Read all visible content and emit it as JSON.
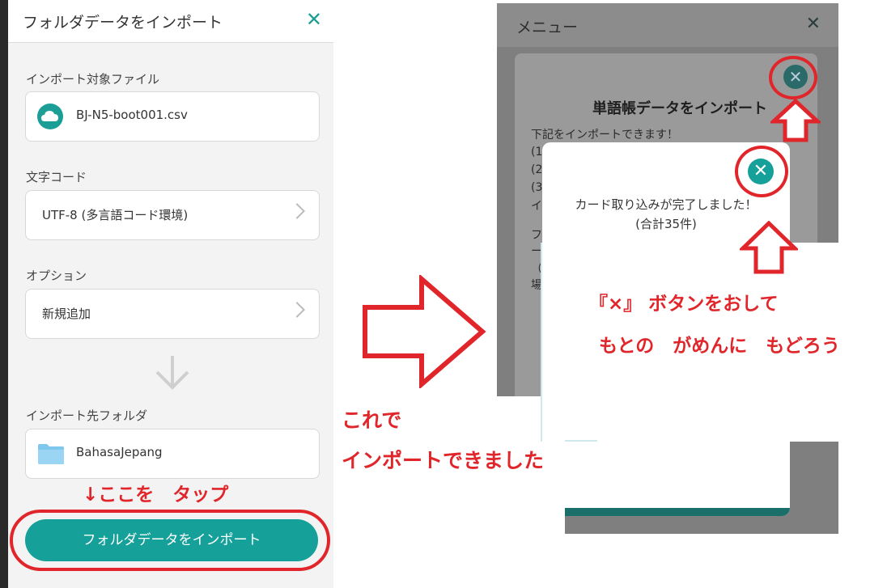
{
  "left_panel": {
    "title": "フォルダデータをインポート",
    "close_glyph": "✕",
    "import_file": {
      "label": "インポート対象ファイル",
      "value": "BJ-N5-boot001.csv",
      "icon": "cloud-icon"
    },
    "encoding": {
      "label": "文字コード",
      "value": "UTF-8 (多言語コード環境)"
    },
    "option": {
      "label": "オプション",
      "value": "新規追加"
    },
    "dest_folder": {
      "label": "インポート先フォルダ",
      "value": "BahasaJepang",
      "icon": "folder-icon"
    },
    "tap_note": "↓ここを　タップ",
    "import_button": "フォルダデータをインポート"
  },
  "done_note": {
    "line1": "これで",
    "line2": "インポートできました"
  },
  "right_screen": {
    "menu_title": "メニュー",
    "menu_close": "✕",
    "outer_dialog": {
      "title": "単語帳データをインポート",
      "line1": "下記をインポートできます！",
      "fragments": [
        "(1",
        "(2",
        "(3",
        "イ",
        "フ",
        "ー",
        "（",
        "場"
      ]
    },
    "inner_dialog": {
      "message": "カード取り込みが完了しました！",
      "count": "(合計35件)",
      "close_glyph": "✕"
    },
    "instruction": {
      "line1": "『×』 ボタンをおして",
      "line2": "もとの　がめんに　もどろう"
    }
  },
  "colors": {
    "accent": "#15a099",
    "annotation_red": "#e0262b",
    "panel_bg": "#f3f3f3",
    "dim_overlay": "#7f7f7f"
  }
}
